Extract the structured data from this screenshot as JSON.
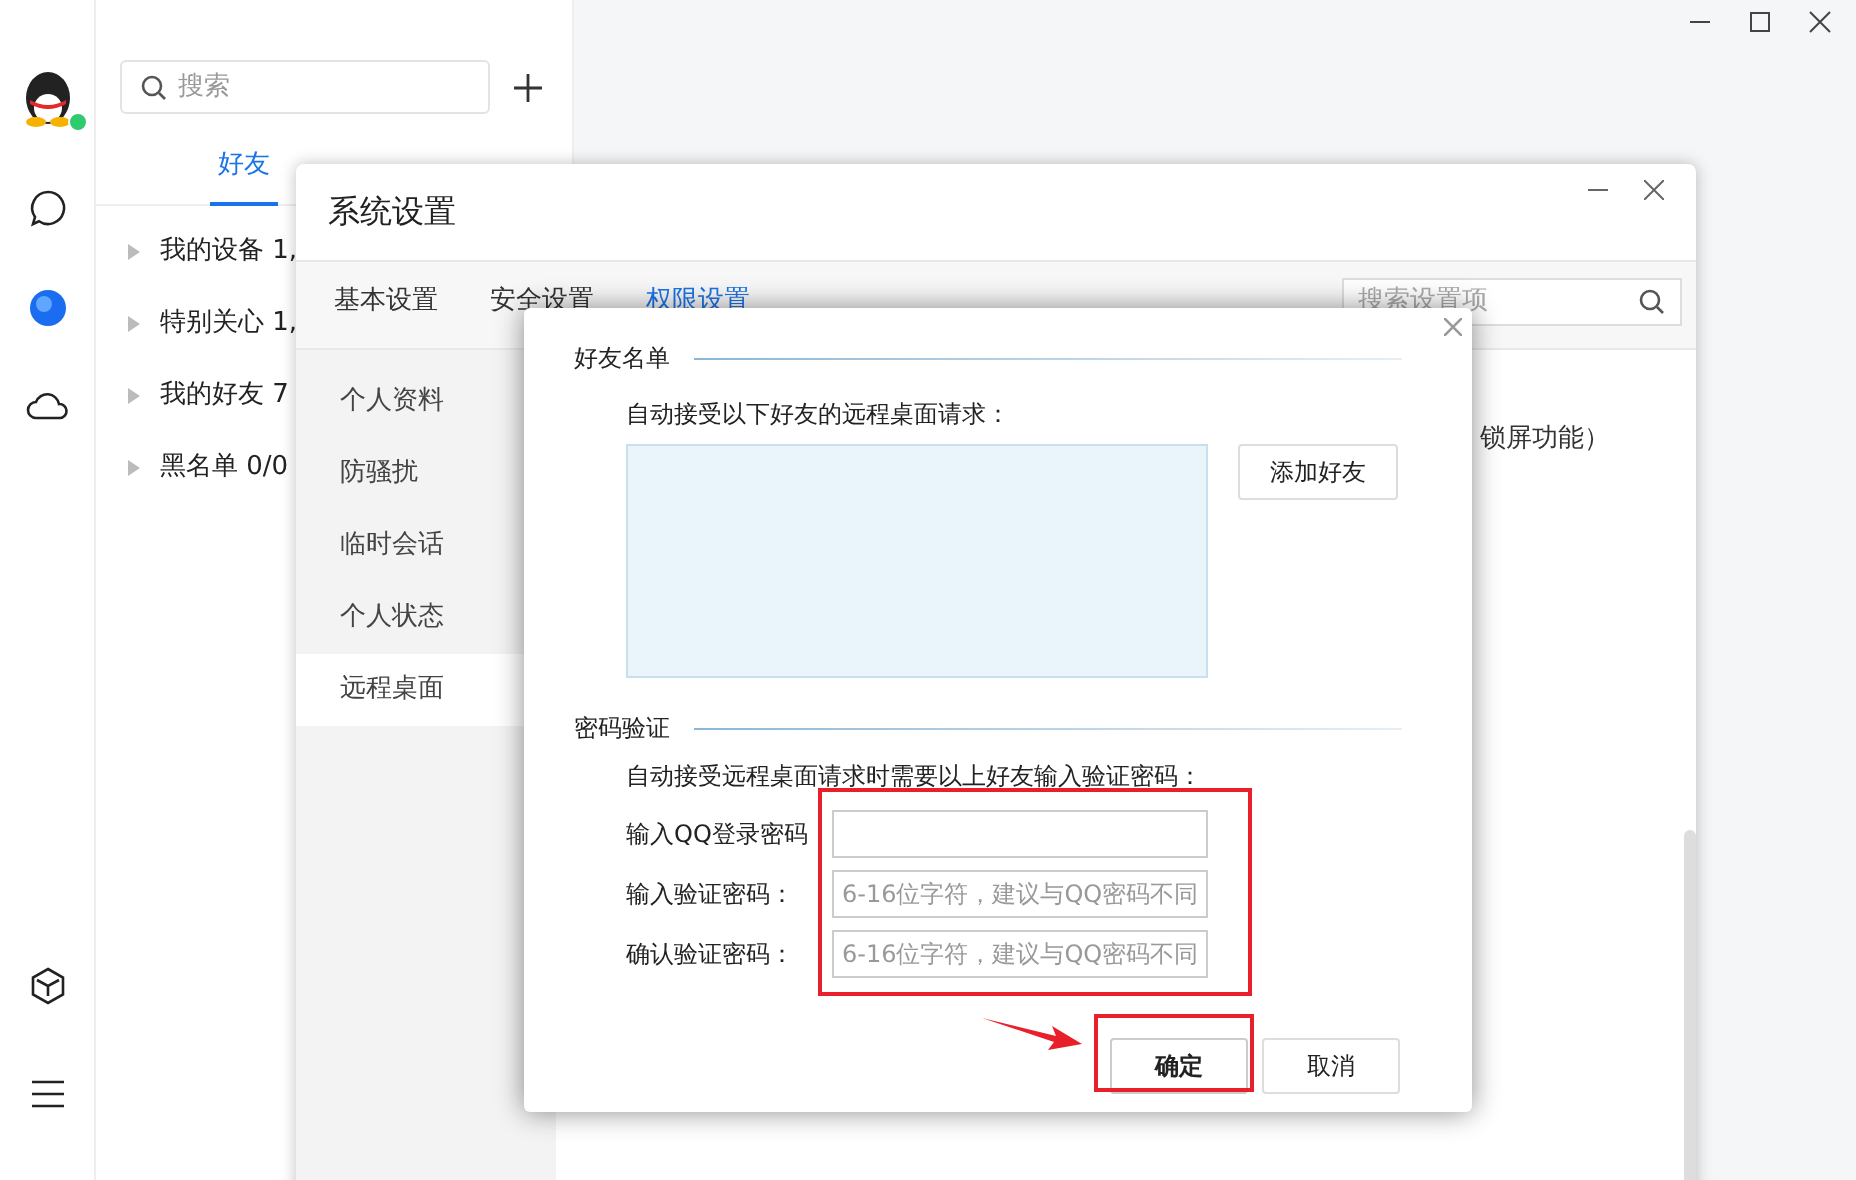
{
  "main_window": {
    "search": {
      "placeholder": "搜索"
    },
    "tabs": [
      {
        "label": "好友",
        "selected": true
      }
    ],
    "groups": [
      {
        "label": "我的设备 1,",
        "expanded": false
      },
      {
        "label": "特别关心 1,",
        "expanded": false
      },
      {
        "label": "我的好友 7",
        "expanded": false
      },
      {
        "label": "黑名单 0/0",
        "expanded": false
      }
    ]
  },
  "settings_window": {
    "title": "系统设置",
    "tabs": [
      {
        "label": "基本设置",
        "selected": false
      },
      {
        "label": "安全设置",
        "selected": false
      },
      {
        "label": "权限设置",
        "selected": true
      }
    ],
    "search": {
      "placeholder": "搜索设置项"
    },
    "nav": [
      {
        "label": "个人资料",
        "selected": false
      },
      {
        "label": "防骚扰",
        "selected": false
      },
      {
        "label": "临时会话",
        "selected": false
      },
      {
        "label": "个人状态",
        "selected": false
      },
      {
        "label": "远程桌面",
        "selected": true
      }
    ],
    "content_text": "锁屏功能）"
  },
  "dialog": {
    "friends_section": {
      "title": "好友名单",
      "description": "自动接受以下好友的远程桌面请求：",
      "add_button": "添加好友"
    },
    "password_section": {
      "title": "密码验证",
      "description": "自动接受远程桌面请求时需要以上好友输入验证密码：",
      "fields": [
        {
          "label": "输入QQ登录密码"
        },
        {
          "label": "输入验证密码：",
          "placeholder": "6-16位字符，建议与QQ密码不同"
        },
        {
          "label": "确认验证密码：",
          "placeholder": "6-16位字符，建议与QQ密码不同"
        }
      ]
    },
    "buttons": [
      {
        "label": "确定",
        "kind": "primary"
      },
      {
        "label": "取消",
        "kind": "secondary"
      }
    ]
  }
}
